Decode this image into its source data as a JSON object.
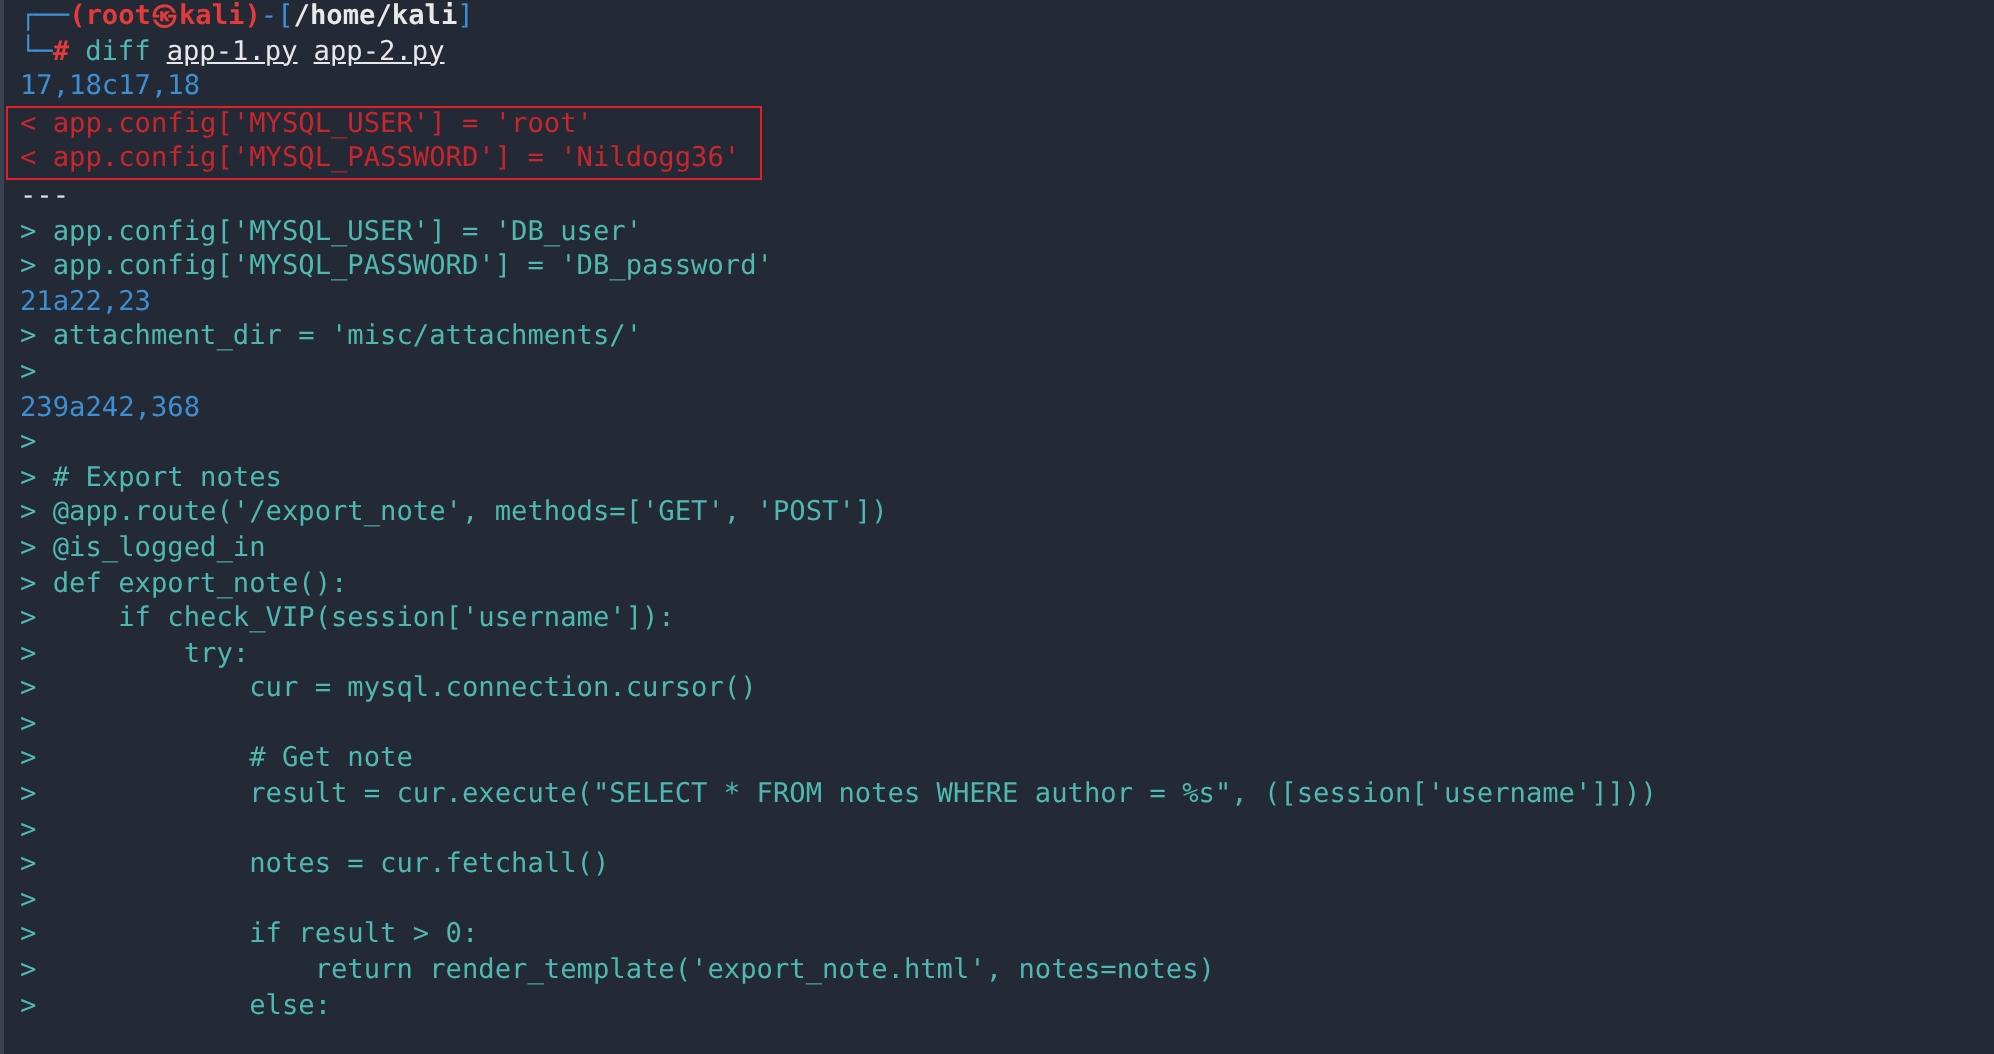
{
  "prompt": {
    "line_1": [
      {
        "kind": "frame",
        "text": "┌──"
      },
      {
        "kind": "user",
        "text": "(root㉿kali)"
      },
      {
        "kind": "frame",
        "text": "-["
      },
      {
        "kind": "path",
        "text": "/home/kali"
      },
      {
        "kind": "frame",
        "text": "]"
      }
    ],
    "line_2": [
      {
        "kind": "frame",
        "text": "└─"
      },
      {
        "kind": "symbol",
        "text": "#"
      },
      {
        "kind": "command",
        "text": "diff"
      },
      {
        "kind": "file",
        "text": "app-1.py"
      },
      {
        "kind": "file",
        "text": "app-2.py"
      }
    ]
  },
  "lines": [
    {
      "kind": "hunk",
      "text": "17,18c17,18",
      "highlighted": false
    },
    {
      "kind": "removed",
      "text": "< app.config['MYSQL_USER'] = 'root'",
      "highlighted": true
    },
    {
      "kind": "removed",
      "text": "< app.config['MYSQL_PASSWORD'] = 'Nildogg36'",
      "highlighted": true
    },
    {
      "kind": "separator",
      "text": "---",
      "highlighted": false
    },
    {
      "kind": "added",
      "text": "> app.config['MYSQL_USER'] = 'DB_user'",
      "highlighted": false
    },
    {
      "kind": "added",
      "text": "> app.config['MYSQL_PASSWORD'] = 'DB_password'",
      "highlighted": false
    },
    {
      "kind": "hunk",
      "text": "21a22,23",
      "highlighted": false
    },
    {
      "kind": "added",
      "text": "> attachment_dir = 'misc/attachments/'",
      "highlighted": false
    },
    {
      "kind": "added",
      "text": ">",
      "highlighted": false
    },
    {
      "kind": "hunk",
      "text": "239a242,368",
      "highlighted": false
    },
    {
      "kind": "added",
      "text": ">",
      "highlighted": false
    },
    {
      "kind": "added",
      "text": "> # Export notes",
      "highlighted": false
    },
    {
      "kind": "added",
      "text": "> @app.route('/export_note', methods=['GET', 'POST'])",
      "highlighted": false
    },
    {
      "kind": "added",
      "text": "> @is_logged_in",
      "highlighted": false
    },
    {
      "kind": "added",
      "text": "> def export_note():",
      "highlighted": false
    },
    {
      "kind": "added",
      "text": ">     if check_VIP(session['username']):",
      "highlighted": false
    },
    {
      "kind": "added",
      "text": ">         try:",
      "highlighted": false
    },
    {
      "kind": "added",
      "text": ">             cur = mysql.connection.cursor()",
      "highlighted": false
    },
    {
      "kind": "added",
      "text": ">",
      "highlighted": false
    },
    {
      "kind": "added",
      "text": ">             # Get note",
      "highlighted": false
    },
    {
      "kind": "added",
      "text": ">             result = cur.execute(\"SELECT * FROM notes WHERE author = %s\", ([session['username']]))",
      "highlighted": false
    },
    {
      "kind": "added",
      "text": ">",
      "highlighted": false
    },
    {
      "kind": "added",
      "text": ">             notes = cur.fetchall()",
      "highlighted": false
    },
    {
      "kind": "added",
      "text": ">",
      "highlighted": false
    },
    {
      "kind": "added",
      "text": ">             if result > 0:",
      "highlighted": false
    },
    {
      "kind": "added",
      "text": ">                 return render_template('export_note.html', notes=notes)",
      "highlighted": false
    },
    {
      "kind": "added",
      "text": ">             else:",
      "highlighted": false
    }
  ]
}
